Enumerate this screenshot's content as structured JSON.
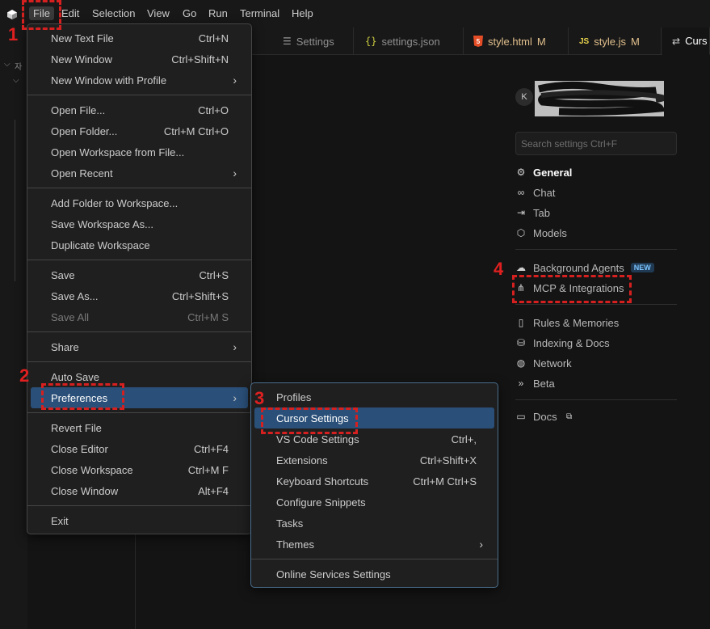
{
  "menubar": {
    "items": [
      "File",
      "Edit",
      "Selection",
      "View",
      "Go",
      "Run",
      "Terminal",
      "Help"
    ]
  },
  "sidebar": {
    "fragment_text": "자"
  },
  "tabs": [
    {
      "label": "Settings",
      "icon": "settings-lines-icon"
    },
    {
      "label": "settings.json",
      "icon": "json-icon"
    },
    {
      "label": "style.html",
      "icon": "html5-icon",
      "modified_marker": "M"
    },
    {
      "label": "style.js",
      "icon": "js-icon",
      "modified_marker": "M"
    },
    {
      "label": "Curs",
      "icon": "cursor-settings-icon"
    }
  ],
  "file_menu": {
    "groups": [
      [
        {
          "label": "New Text File",
          "shortcut": "Ctrl+N"
        },
        {
          "label": "New Window",
          "shortcut": "Ctrl+Shift+N"
        },
        {
          "label": "New Window with Profile",
          "submenu": true
        }
      ],
      [
        {
          "label": "Open File...",
          "shortcut": "Ctrl+O"
        },
        {
          "label": "Open Folder...",
          "shortcut": "Ctrl+M Ctrl+O"
        },
        {
          "label": "Open Workspace from File..."
        },
        {
          "label": "Open Recent",
          "submenu": true
        }
      ],
      [
        {
          "label": "Add Folder to Workspace..."
        },
        {
          "label": "Save Workspace As..."
        },
        {
          "label": "Duplicate Workspace"
        }
      ],
      [
        {
          "label": "Save",
          "shortcut": "Ctrl+S"
        },
        {
          "label": "Save As...",
          "shortcut": "Ctrl+Shift+S"
        },
        {
          "label": "Save All",
          "shortcut": "Ctrl+M S",
          "disabled": true
        }
      ],
      [
        {
          "label": "Share",
          "submenu": true
        }
      ],
      [
        {
          "label": "Auto Save"
        },
        {
          "label": "Preferences",
          "submenu": true,
          "highlighted": true
        }
      ],
      [
        {
          "label": "Revert File"
        },
        {
          "label": "Close Editor",
          "shortcut": "Ctrl+F4"
        },
        {
          "label": "Close Workspace",
          "shortcut": "Ctrl+M F"
        },
        {
          "label": "Close Window",
          "shortcut": "Alt+F4"
        }
      ],
      [
        {
          "label": "Exit"
        }
      ]
    ]
  },
  "preferences_submenu": {
    "groups": [
      [
        {
          "label": "Profiles"
        },
        {
          "label": "Cursor Settings",
          "highlighted": true
        },
        {
          "label": "VS Code Settings",
          "shortcut": "Ctrl+,"
        },
        {
          "label": "Extensions",
          "shortcut": "Ctrl+Shift+X"
        },
        {
          "label": "Keyboard Shortcuts",
          "shortcut": "Ctrl+M Ctrl+S"
        },
        {
          "label": "Configure Snippets"
        },
        {
          "label": "Tasks"
        },
        {
          "label": "Themes",
          "submenu": true
        }
      ],
      [
        {
          "label": "Online Services Settings"
        }
      ]
    ]
  },
  "cursor_settings": {
    "avatar_initial": "K",
    "search_placeholder": "Search settings Ctrl+F",
    "nav_groups": [
      [
        {
          "label": "General",
          "icon": "gear-icon",
          "active": true
        },
        {
          "label": "Chat",
          "icon": "infinity-icon"
        },
        {
          "label": "Tab",
          "icon": "tab-arrow-icon"
        },
        {
          "label": "Models",
          "icon": "cube-icon"
        }
      ],
      [
        {
          "label": "Background Agents",
          "icon": "cloud-icon",
          "badge": "NEW"
        },
        {
          "label": "MCP & Integrations",
          "icon": "mcp-nodes-icon"
        }
      ],
      [
        {
          "label": "Rules & Memories",
          "icon": "document-icon"
        },
        {
          "label": "Indexing & Docs",
          "icon": "database-icon"
        },
        {
          "label": "Network",
          "icon": "globe-icon"
        },
        {
          "label": "Beta",
          "icon": "chevrons-right-icon"
        }
      ],
      [
        {
          "label": "Docs",
          "icon": "book-icon",
          "external_icon": "external-link-icon"
        }
      ]
    ]
  },
  "annotations": [
    "1",
    "2",
    "3",
    "4"
  ],
  "colors": {
    "annotation": "#d62020",
    "highlight": "#2a4f78",
    "modified": "#e2c08d"
  }
}
